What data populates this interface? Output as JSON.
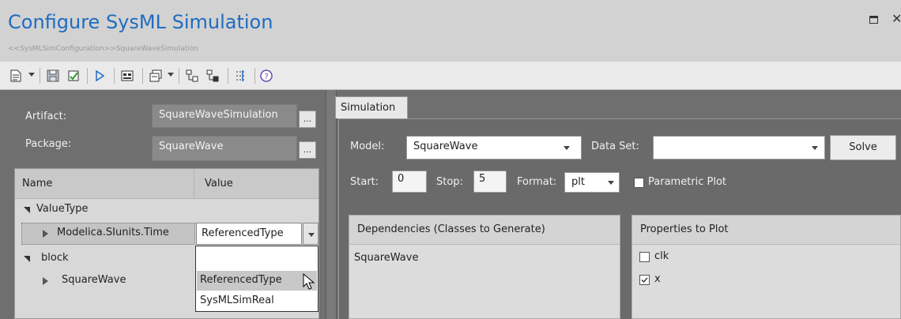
{
  "window": {
    "title": "Configure SysML Simulation",
    "subtitle": "<<SysMLSimConfiguration>>SquareWaveSimulation"
  },
  "toolbar": {
    "icons": [
      "new-document-icon",
      "save-icon",
      "validate-icon",
      "run-icon",
      "generate-icon",
      "export-icon",
      "add-element-icon",
      "remove-element-icon",
      "filter-icon",
      "help-icon"
    ]
  },
  "left": {
    "artifact_label": "Artifact:",
    "artifact_value": "SquareWaveSimulation",
    "package_label": "Package:",
    "package_value": "SquareWave",
    "ellipsis": "...",
    "grid": {
      "col_name": "Name",
      "col_value": "Value",
      "rows": [
        {
          "label": "ValueType"
        },
        {
          "label": "Modelica.SIunits.Time",
          "value": "ReferencedType"
        },
        {
          "label": "block"
        },
        {
          "label": "SquareWave"
        }
      ],
      "dropdown_options": [
        "",
        "ReferencedType",
        "SysMLSimReal"
      ]
    }
  },
  "right": {
    "tab": "Simulation",
    "model_label": "Model:",
    "model_value": "SquareWave",
    "dataset_label": "Data Set:",
    "dataset_value": "",
    "solve": "Solve",
    "start_label": "Start:",
    "start_value": "0",
    "stop_label": "Stop:",
    "stop_value": "5",
    "format_label": "Format:",
    "format_value": "plt",
    "parametric_label": "Parametric Plot",
    "dependencies_title": "Dependencies (Classes to Generate)",
    "dependencies": [
      "SquareWave"
    ],
    "properties_title": "Properties to Plot",
    "properties": [
      {
        "label": "clk",
        "checked": false
      },
      {
        "label": "x",
        "checked": true
      }
    ]
  },
  "colors": {
    "title_blue": "#1f6cc1",
    "panel_dark": "#6f6f6f",
    "selection": "#c8c8c8"
  }
}
